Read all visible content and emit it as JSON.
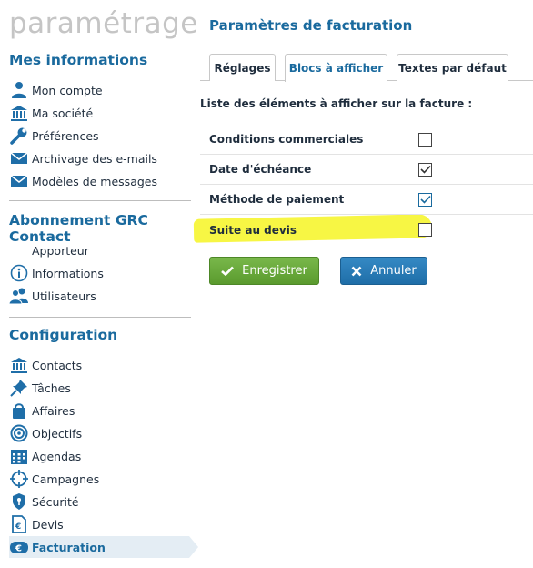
{
  "app_title": "paramétrage",
  "sidebar": {
    "sections": [
      {
        "title": "Mes informations",
        "items": [
          {
            "label": "Mon compte",
            "icon": "user-icon"
          },
          {
            "label": "Ma société",
            "icon": "bank-icon"
          },
          {
            "label": "Préférences",
            "icon": "wrench-icon"
          },
          {
            "label": "Archivage des e-mails",
            "icon": "envelope-icon"
          },
          {
            "label": "Modèles de messages",
            "icon": "envelope-icon"
          }
        ]
      },
      {
        "title": "Abonnement GRC Contact",
        "items": [
          {
            "label": "Apporteur",
            "icon": ""
          },
          {
            "label": "Informations",
            "icon": "info-icon"
          },
          {
            "label": "Utilisateurs",
            "icon": "users-icon"
          }
        ]
      },
      {
        "title": "Configuration",
        "items": [
          {
            "label": "Contacts",
            "icon": "bank-icon"
          },
          {
            "label": "Tâches",
            "icon": "pin-icon"
          },
          {
            "label": "Affaires",
            "icon": "bag-icon"
          },
          {
            "label": "Objectifs",
            "icon": "target-icon"
          },
          {
            "label": "Agendas",
            "icon": "calendar-icon"
          },
          {
            "label": "Campagnes",
            "icon": "crosshair-icon"
          },
          {
            "label": "Sécurité",
            "icon": "shield-icon"
          },
          {
            "label": "Devis",
            "icon": "document-icon"
          },
          {
            "label": "Facturation",
            "icon": "euro-icon",
            "active": true
          }
        ]
      }
    ]
  },
  "main": {
    "title": "Paramètres de facturation",
    "tabs": [
      {
        "label": "Réglages",
        "active": false
      },
      {
        "label": "Blocs à afficher",
        "active": true
      },
      {
        "label": "Textes par défaut",
        "active": false
      }
    ],
    "intro": "Liste des éléments à afficher sur la facture :",
    "rows": [
      {
        "label": "Conditions commerciales",
        "checked": false,
        "highlighted": false
      },
      {
        "label": "Date d'échéance",
        "checked": true,
        "highlighted": false
      },
      {
        "label": "Méthode de paiement",
        "checked": true,
        "highlighted": false
      },
      {
        "label": "Suite au devis",
        "checked": false,
        "highlighted": true
      }
    ],
    "buttons": {
      "save_label": "Enregistrer",
      "cancel_label": "Annuler"
    }
  },
  "colors": {
    "accent": "#1a6a9e",
    "save_button": "#6aa93c",
    "cancel_button": "#2a7cb8",
    "highlight": "#f7f63a",
    "active_nav_bg": "#e4edf4"
  }
}
